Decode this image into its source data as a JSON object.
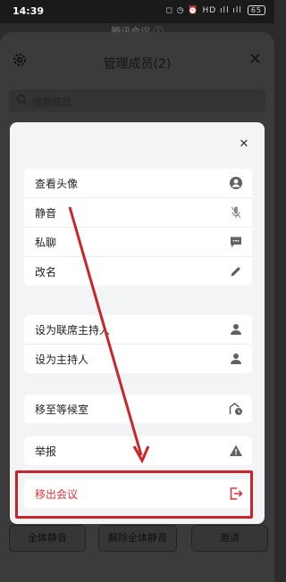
{
  "status_bar": {
    "time": "14:39",
    "icons": "◻ ◷ ⏰ HD ıll ıll",
    "battery": "65"
  },
  "behind_title": "腾讯会议 ⓘ",
  "sheet": {
    "title": "管理成员(2)",
    "search_placeholder": "搜索成员",
    "buttons": [
      "全体静音",
      "解除全体静音",
      "邀请"
    ]
  },
  "modal": {
    "groups": [
      [
        {
          "label": "查看头像",
          "icon": "avatar-circle-icon"
        },
        {
          "label": "静音",
          "icon": "mic-off-icon"
        },
        {
          "label": "私聊",
          "icon": "chat-bubble-icon"
        },
        {
          "label": "改名",
          "icon": "pencil-icon"
        }
      ],
      [
        {
          "label": "设为联席主持人",
          "icon": "person-icon"
        },
        {
          "label": "设为主持人",
          "icon": "person-icon"
        }
      ],
      [
        {
          "label": "移至等候室",
          "icon": "waiting-room-icon"
        }
      ],
      [
        {
          "label": "举报",
          "icon": "warning-icon"
        }
      ],
      [
        {
          "label": "移出会议",
          "icon": "exit-icon"
        }
      ]
    ]
  },
  "colors": {
    "danger": "#d9363e",
    "highlight": "#c8262a"
  }
}
